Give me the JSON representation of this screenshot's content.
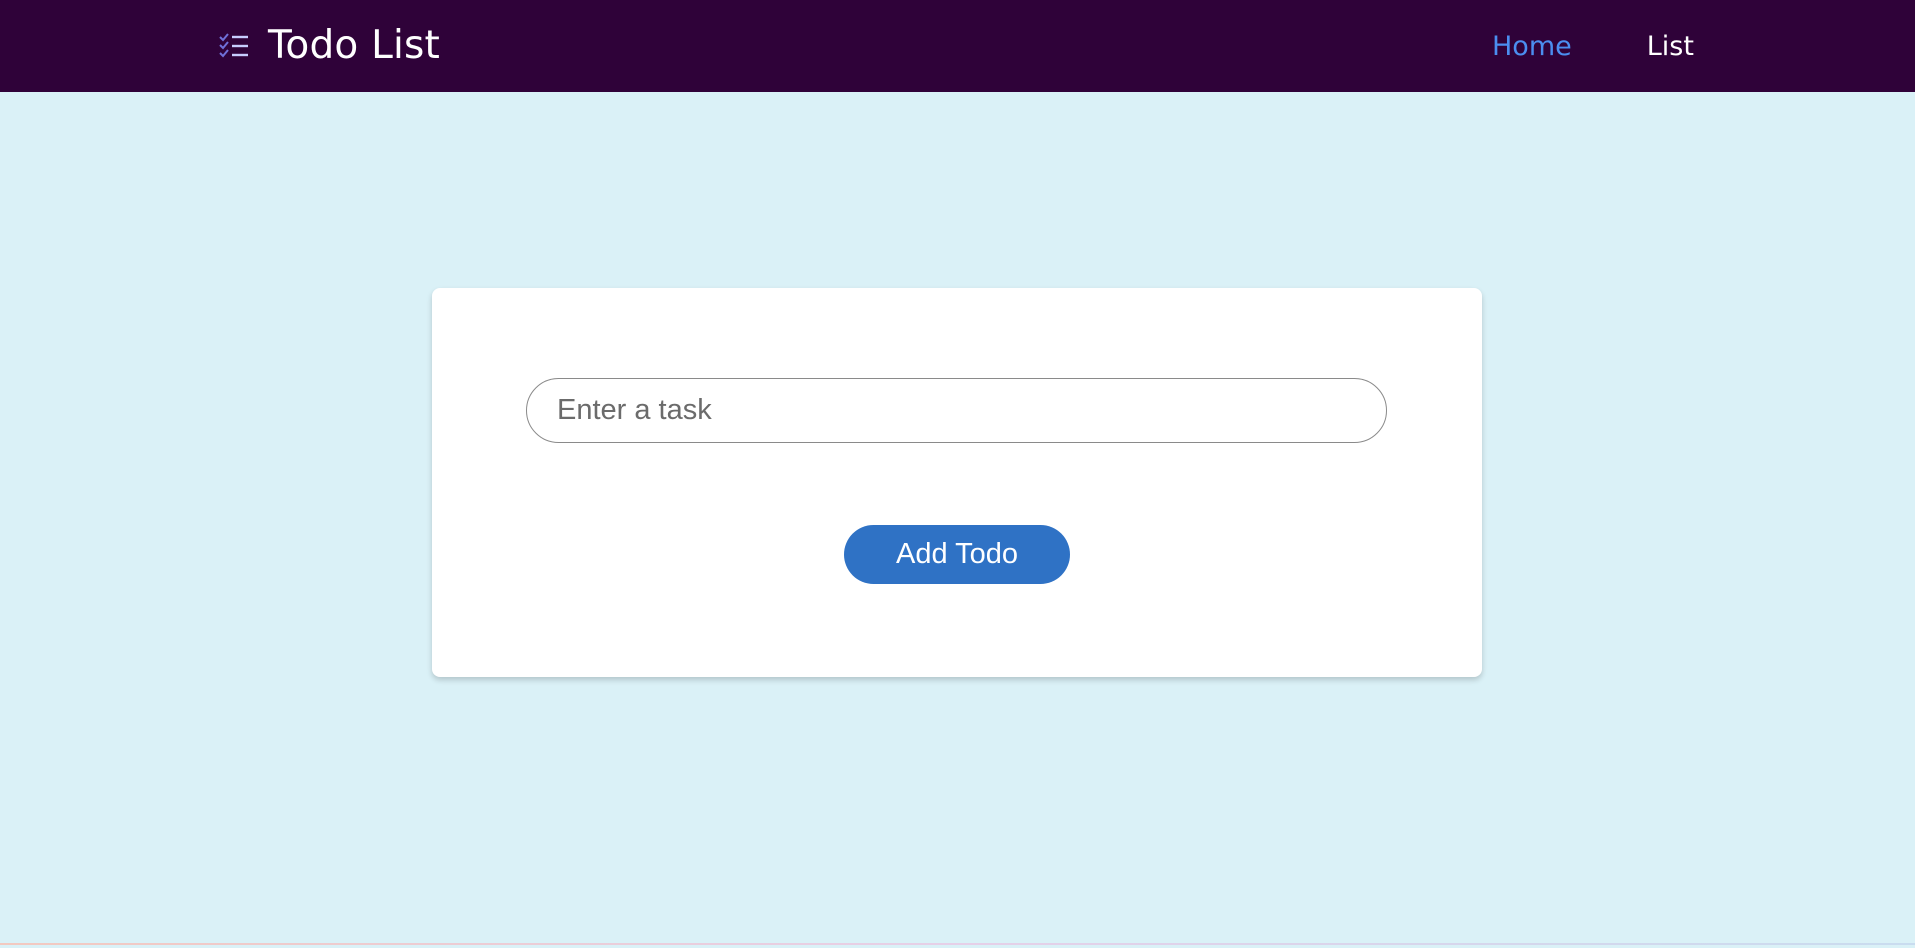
{
  "navbar": {
    "brand_icon": "checklist-icon",
    "title": "Todo List",
    "links": [
      {
        "label": "Home",
        "active": true
      },
      {
        "label": "List",
        "active": false
      }
    ]
  },
  "form": {
    "task_input": {
      "placeholder": "Enter a task",
      "value": ""
    },
    "add_button_label": "Add Todo"
  },
  "colors": {
    "navbar_bg": "#2f0239",
    "page_bg": "#daf1f7",
    "active_link": "#4b8ef0",
    "button_bg": "#2f72c5"
  }
}
